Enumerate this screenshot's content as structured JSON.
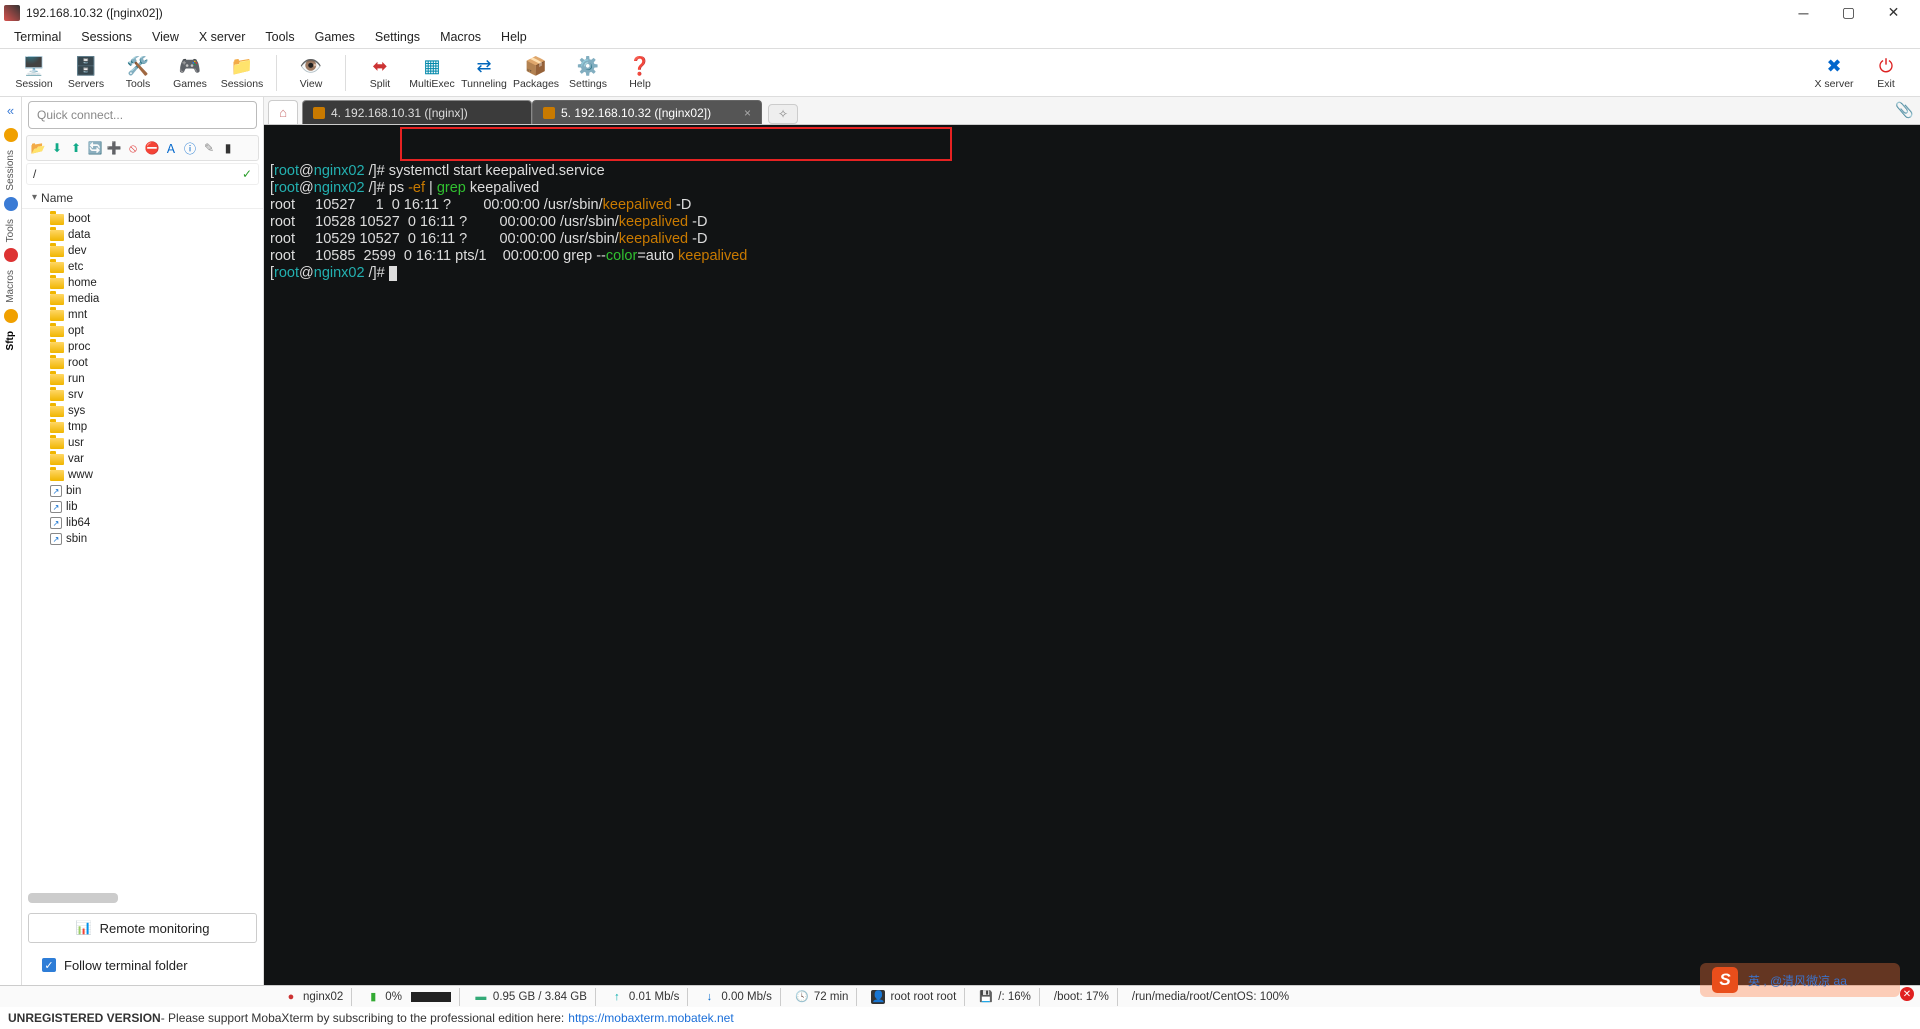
{
  "window": {
    "title": "192.168.10.32 ([nginx02])"
  },
  "menu": [
    "Terminal",
    "Sessions",
    "View",
    "X server",
    "Tools",
    "Games",
    "Settings",
    "Macros",
    "Help"
  ],
  "toolbar_main": [
    {
      "name": "session",
      "label": "Session",
      "icon": "🖥️",
      "color": "#3a7"
    },
    {
      "name": "servers",
      "label": "Servers",
      "icon": "🗄️",
      "color": "#39d"
    },
    {
      "name": "tools",
      "label": "Tools",
      "icon": "🛠️",
      "color": "#a84"
    },
    {
      "name": "games",
      "label": "Games",
      "icon": "🎮",
      "color": "#d33"
    },
    {
      "name": "sessions",
      "label": "Sessions",
      "icon": "📁",
      "color": "#c80"
    }
  ],
  "toolbar_view": [
    {
      "name": "view",
      "label": "View",
      "icon": "👁️",
      "color": "#38a"
    }
  ],
  "toolbar_actions": [
    {
      "name": "split",
      "label": "Split",
      "icon": "⬌",
      "color": "#c33"
    },
    {
      "name": "multiexec",
      "label": "MultiExec",
      "icon": "▦",
      "color": "#08a"
    },
    {
      "name": "tunneling",
      "label": "Tunneling",
      "icon": "⇄",
      "color": "#06b"
    },
    {
      "name": "packages",
      "label": "Packages",
      "icon": "📦",
      "color": "#a60"
    },
    {
      "name": "settings",
      "label": "Settings",
      "icon": "⚙️",
      "color": "#06c"
    },
    {
      "name": "help",
      "label": "Help",
      "icon": "❓",
      "color": "#0aa"
    }
  ],
  "toolbar_right": [
    {
      "name": "xserver",
      "label": "X server",
      "icon": "✖",
      "color": "#06c"
    },
    {
      "name": "exit",
      "label": "Exit",
      "icon": "⏻",
      "color": "#d22"
    }
  ],
  "sidebar": {
    "v_tabs": [
      {
        "label": "Sessions",
        "icon_color": "#f0a000"
      },
      {
        "label": "Tools",
        "icon_color": "#3a7bd5"
      },
      {
        "label": "Macros",
        "icon_color": "#d33"
      },
      {
        "label": "Sftp",
        "icon_color": "#f0a000",
        "active": true
      }
    ],
    "quick_connect_placeholder": "Quick connect...",
    "sftp_toolbar_icons": [
      "folder-up-icon",
      "download-icon",
      "upload-icon",
      "refresh-icon",
      "newfolder-icon",
      "delete-icon",
      "stop-icon",
      "rename-icon",
      "perms-icon",
      "edit-icon",
      "terminal-icon"
    ],
    "path": "/",
    "path_ok": "✓",
    "name_header": "Name",
    "tree": [
      {
        "n": "boot",
        "t": "d"
      },
      {
        "n": "data",
        "t": "d"
      },
      {
        "n": "dev",
        "t": "d"
      },
      {
        "n": "etc",
        "t": "d"
      },
      {
        "n": "home",
        "t": "d"
      },
      {
        "n": "media",
        "t": "d"
      },
      {
        "n": "mnt",
        "t": "d"
      },
      {
        "n": "opt",
        "t": "d"
      },
      {
        "n": "proc",
        "t": "d"
      },
      {
        "n": "root",
        "t": "d"
      },
      {
        "n": "run",
        "t": "d"
      },
      {
        "n": "srv",
        "t": "d"
      },
      {
        "n": "sys",
        "t": "d"
      },
      {
        "n": "tmp",
        "t": "d"
      },
      {
        "n": "usr",
        "t": "d"
      },
      {
        "n": "var",
        "t": "d"
      },
      {
        "n": "www",
        "t": "d"
      },
      {
        "n": "bin",
        "t": "l"
      },
      {
        "n": "lib",
        "t": "l"
      },
      {
        "n": "lib64",
        "t": "l"
      },
      {
        "n": "sbin",
        "t": "l"
      }
    ],
    "remote_monitoring": "Remote monitoring",
    "follow_label": "Follow terminal folder"
  },
  "tabs": {
    "inactive": {
      "label": "4. 192.168.10.31 ([nginx])"
    },
    "active": {
      "label": "5. 192.168.10.32 ([nginx02])"
    }
  },
  "terminal": {
    "prompt_user": "root",
    "prompt_host": "nginx02",
    "prompt_path": "/",
    "cmd1_a": "systemctl start keepalived.service",
    "cmd2_a": "ps ",
    "cmd2_b": "-ef",
    "cmd2_c": " | ",
    "cmd2_d": "grep",
    "cmd2_e": " keepalived",
    "line3_a": "root     10527     1  0 16:11 ?        00:00:00 /usr/sbin/",
    "line3_b": "keepalived",
    "line3_c": " -D",
    "line4_a": "root     10528 10527  0 16:11 ?        00:00:00 /usr/sbin/",
    "line4_b": "keepalived",
    "line4_c": " -D",
    "line5_a": "root     10529 10527  0 16:11 ?        00:00:00 /usr/sbin/",
    "line5_b": "keepalived",
    "line5_c": " -D",
    "line6_a": "root     10585  2599  0 16:11 pts/1    00:00:00 grep --",
    "line6_b": "color",
    "line6_c": "=auto ",
    "line6_d": "keepalived"
  },
  "status": {
    "host": "nginx02",
    "cpu": "0%",
    "mem": "0.95 GB / 3.84 GB",
    "up": "0.01 Mb/s",
    "down": "0.00 Mb/s",
    "uptime": "72 min",
    "users": "root  root  root",
    "disk_root": "/: 16%",
    "disk_boot": "/boot: 17%",
    "disk_media": "/run/media/root/CentOS: 100%"
  },
  "footer": {
    "bold": "UNREGISTERED VERSION",
    "text": " -  Please support MobaXterm by subscribing to the professional edition here: ",
    "link": "https://mobaxterm.mobatek.net"
  },
  "capsule": {
    "s": "S",
    "text": "英 , @清风微凉 aa"
  }
}
